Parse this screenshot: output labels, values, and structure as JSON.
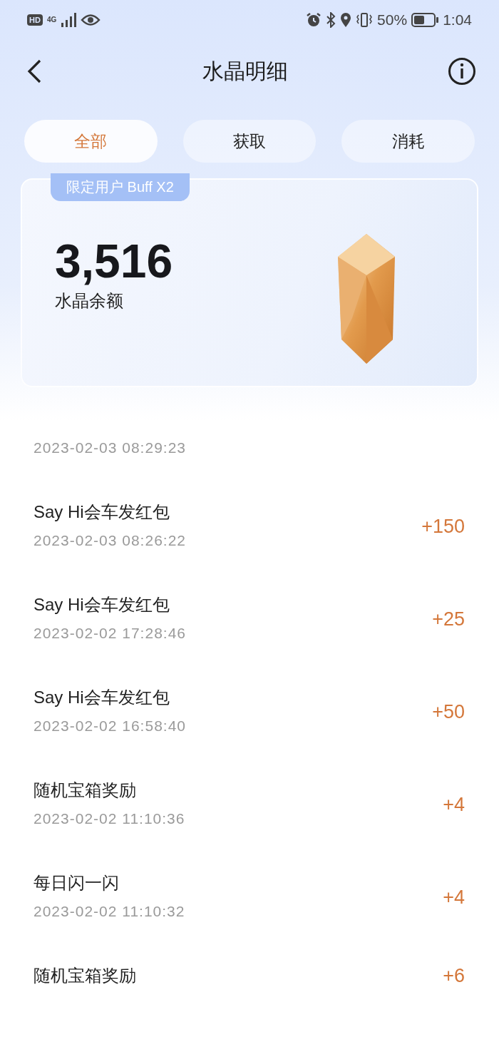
{
  "status_bar": {
    "hd": "HD",
    "network": "4G",
    "battery": "50%",
    "time": "1:04"
  },
  "header": {
    "title": "水晶明细"
  },
  "tabs": [
    {
      "label": "全部",
      "selected": true
    },
    {
      "label": "获取",
      "selected": false
    },
    {
      "label": "消耗",
      "selected": false
    }
  ],
  "balance_card": {
    "badge": "限定用户 Buff X2",
    "amount": "3,516",
    "label": "水晶余额"
  },
  "records": [
    {
      "date": "2023-02-03 08:29:23"
    },
    {
      "title": "Say Hi会车发红包",
      "date": "2023-02-03 08:26:22",
      "amount": "+150"
    },
    {
      "title": "Say Hi会车发红包",
      "date": "2023-02-02 17:28:46",
      "amount": "+25"
    },
    {
      "title": "Say Hi会车发红包",
      "date": "2023-02-02 16:58:40",
      "amount": "+50"
    },
    {
      "title": "随机宝箱奖励",
      "date": "2023-02-02 11:10:36",
      "amount": "+4"
    },
    {
      "title": "每日闪一闪",
      "date": "2023-02-02 11:10:32",
      "amount": "+4"
    },
    {
      "title": "随机宝箱奖励",
      "amount": "+6"
    }
  ]
}
